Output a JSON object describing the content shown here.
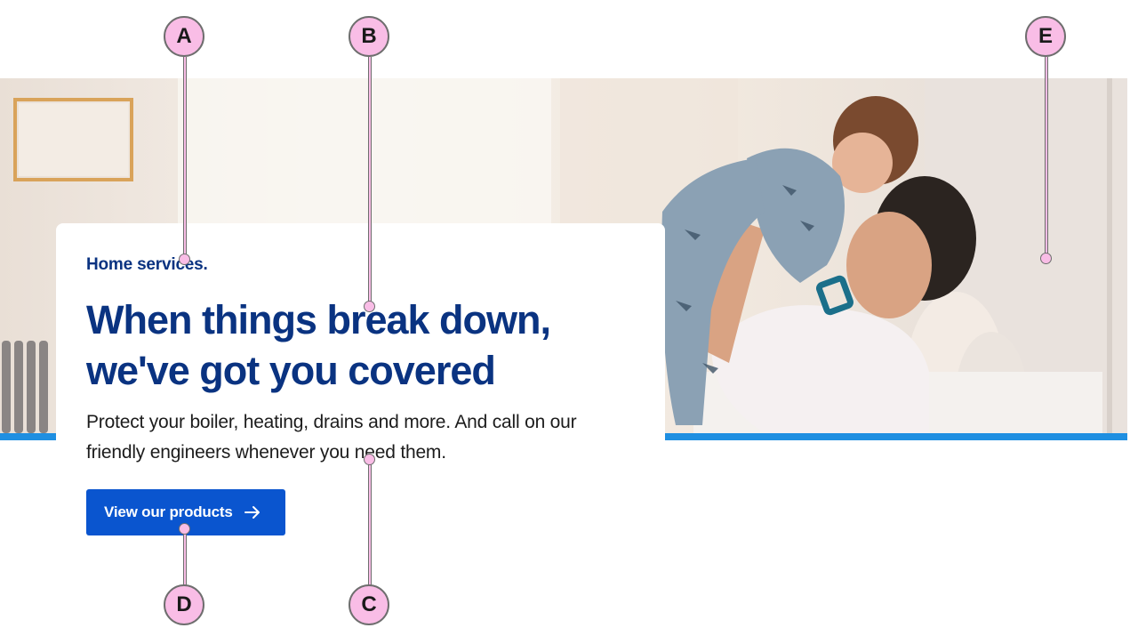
{
  "hero": {
    "eyebrow": "Home services.",
    "headline_line1": "When things break down,",
    "headline_line2": "we've got you covered",
    "body_line1": "Protect your boiler, heating, drains and more. And call on our",
    "body_line2": "friendly engineers whenever you need them.",
    "cta_label": "View our products",
    "cta_icon": "arrow-right-icon",
    "image": "father-lifting-child-photo"
  },
  "annotations": [
    {
      "label": "A"
    },
    {
      "label": "B"
    },
    {
      "label": "C"
    },
    {
      "label": "D"
    },
    {
      "label": "E"
    }
  ],
  "colors": {
    "brand_navy": "#0a3381",
    "cta_blue": "#0a55cf",
    "stripe_blue": "#1f8fe1",
    "callout_pink": "#f9bde6"
  }
}
